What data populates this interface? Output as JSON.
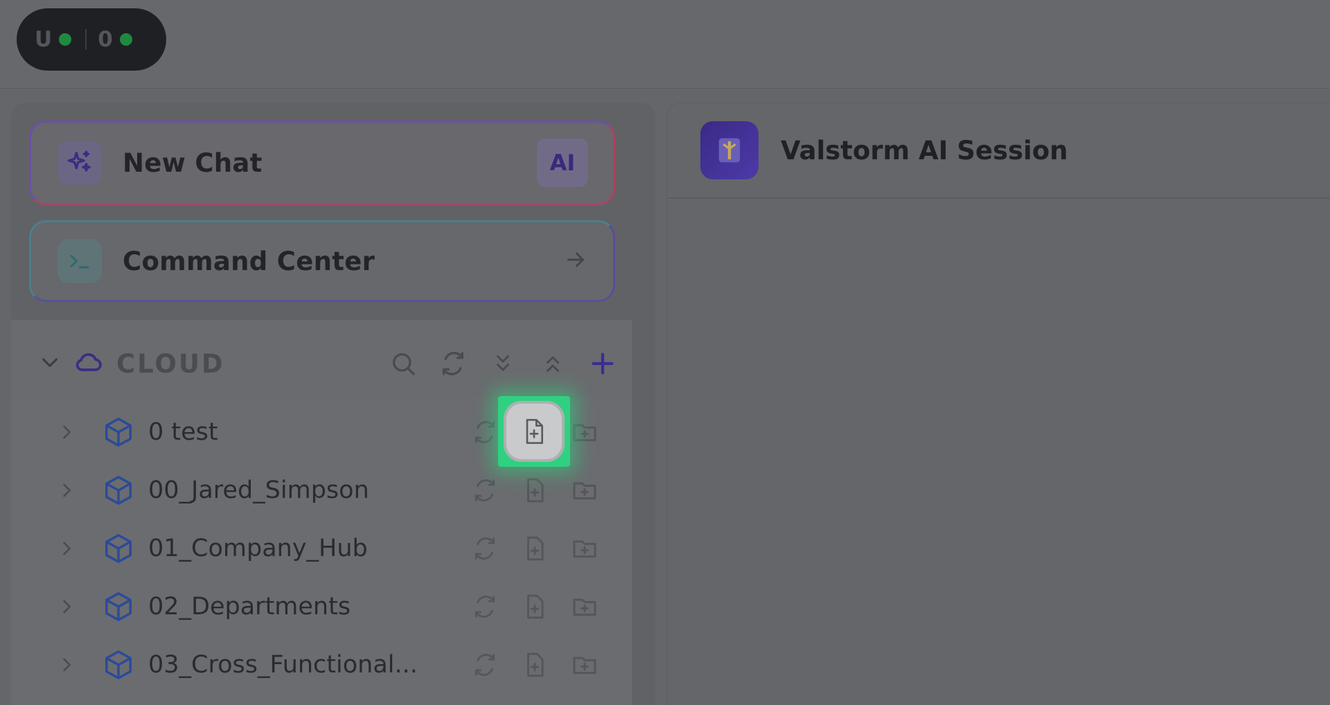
{
  "status": {
    "left_label": "U",
    "right_label": "0",
    "dot_color": "#1f8a3f"
  },
  "sidebar": {
    "new_chat": {
      "label": "New Chat",
      "badge": "AI"
    },
    "command_center": {
      "label": "Command Center"
    },
    "cloud": {
      "title": "CLOUD",
      "items": [
        {
          "label": "0 test"
        },
        {
          "label": "00_Jared_Simpson"
        },
        {
          "label": "01_Company_Hub"
        },
        {
          "label": "02_Departments"
        },
        {
          "label": "03_Cross_Functional..."
        }
      ]
    }
  },
  "main": {
    "title": "Valstorm AI Session"
  },
  "colors": {
    "highlight": "#2fd180",
    "accent": "#3a2a86",
    "cube": "#2a4a9a"
  }
}
